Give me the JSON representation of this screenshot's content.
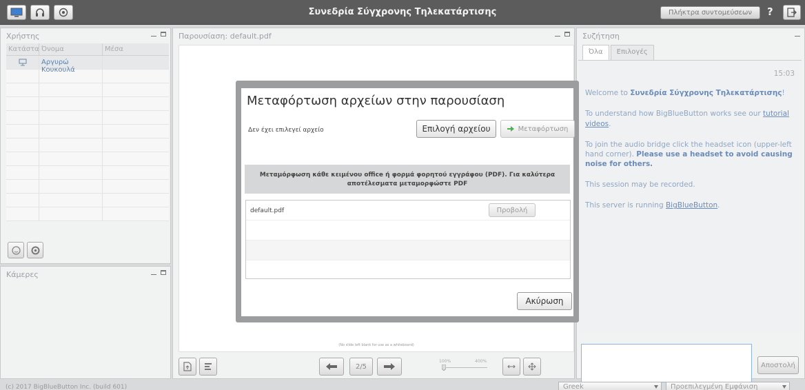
{
  "app": {
    "title": "Συνεδρία Σύγχρονης Τηλεκατάρτισης",
    "shortcuts_label": "Πλήκτρα συντομεύσεων",
    "help_label": "?"
  },
  "users_panel": {
    "title": "Χρήστης",
    "columns": [
      "Κατάστα",
      "Όνομα",
      "Μέσα"
    ],
    "rows": [
      {
        "name": "Αργυρώ Κουκουλά"
      }
    ]
  },
  "webcam_panel": {
    "title": "Κάμερες"
  },
  "presentation": {
    "title": "Παρουσίαση: default.pdf",
    "caption": "(No slide left blank for use as a whiteboard)",
    "page_indicator": "2/5",
    "zoom_min": "100%",
    "zoom_max": "400%"
  },
  "chat": {
    "title": "Συζήτηση",
    "tabs": [
      "Όλα",
      "Επιλογές"
    ],
    "time": "15:03",
    "welcome_prefix": "Welcome to ",
    "welcome_name": "Συνεδρία Σύγχρονης Τηλεκατάρτισης",
    "welcome_suffix": "!",
    "msg_tutorial_prefix": "To understand how BigBlueButton works see our ",
    "msg_tutorial_link": "tutorial videos",
    "msg_tutorial_suffix": ".",
    "msg_audio_prefix": "To join the audio bridge click the headset icon (upper-left hand corner). ",
    "msg_audio_bold": "Please use a headset to avoid causing noise for others.",
    "msg_recorded": "This session may be recorded.",
    "msg_server_prefix": "This server is running ",
    "msg_server_link": "BigBlueButton",
    "msg_server_suffix": ".",
    "send_label": "Αποστολή"
  },
  "footer": {
    "copyright_prefix": "(c) 2017 ",
    "copyright_link": "BigBlueButton Inc.",
    "copyright_suffix": " (build 601)",
    "language": "Greek",
    "layout": "Προεπιλεγμένη Εμφάνιση"
  },
  "upload_dialog": {
    "title": "Μεταφόρτωση αρχείων στην παρουσίαση",
    "no_file": "Δεν έχει επιλεγεί αρχείο",
    "choose_file": "Επιλογή αρχείου",
    "upload": "Μεταφόρτωση",
    "info_line1": "Μεταμόρφωση κάθε κειμένου office ή φορμά φορητού εγγράφου (PDF). Για καλύτερα",
    "info_line2": "αποτέλεσματα μεταμορφώστε PDF",
    "files": [
      {
        "name": "default.pdf",
        "view_label": "Προβολή"
      }
    ],
    "cancel": "Ακύρωση"
  },
  "colors": {
    "topbar": "#5c5c5c",
    "link": "#6b8bb8",
    "upload_arrow": "#4caf50"
  }
}
